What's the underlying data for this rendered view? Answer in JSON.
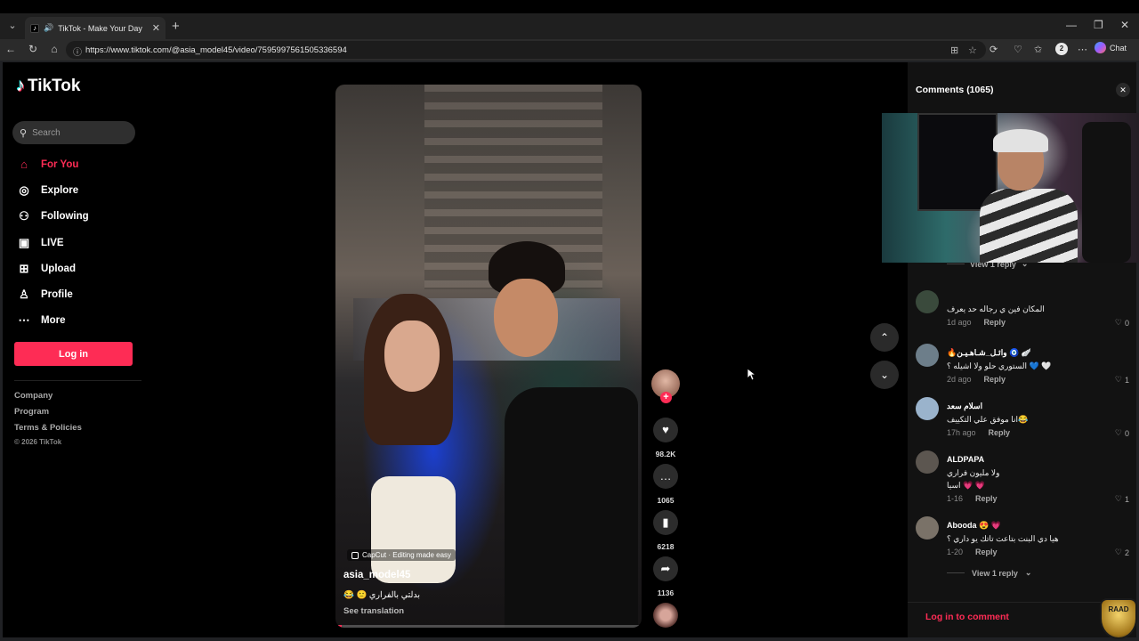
{
  "browser": {
    "tab_title": "TikTok - Make Your Day",
    "url": "https://www.tiktok.com/@asia_model45/video/7595997561505336594",
    "profile_initial": "2",
    "chat_label": "Chat"
  },
  "sidebar": {
    "logo_text": "TikTok",
    "search_placeholder": "Search",
    "nav": [
      {
        "label": "For You",
        "icon": "home-icon",
        "active": true
      },
      {
        "label": "Explore",
        "icon": "compass-icon"
      },
      {
        "label": "Following",
        "icon": "following-icon"
      },
      {
        "label": "LIVE",
        "icon": "live-icon"
      },
      {
        "label": "Upload",
        "icon": "upload-icon"
      },
      {
        "label": "Profile",
        "icon": "profile-icon"
      },
      {
        "label": "More",
        "icon": "more-icon"
      }
    ],
    "login_label": "Log in",
    "footer_links": [
      "Company",
      "Program",
      "Terms & Policies"
    ],
    "copyright": "© 2026 TikTok"
  },
  "video": {
    "capcut_label": "CapCut · Editing made easy",
    "author": "asia_model45",
    "caption": "بدلتي بالفراري 🙂 😂",
    "see_translation": "See translation",
    "progress": 0.02
  },
  "actions": {
    "likes": "98.2K",
    "comments": "1065",
    "saves": "6218",
    "shares": "1136"
  },
  "comments_panel": {
    "title": "Comments",
    "count": "(1065)",
    "view_reply_top": "View 1 reply",
    "items": [
      {
        "name": "",
        "text": "المكان فين ي رجاله حد يعرف",
        "text2": "",
        "time": "1d ago",
        "reply": "Reply",
        "likes": "0"
      },
      {
        "name": "🔥واﺋـﻞ_ﺷـﺎﻫـﻴـﻦ 🧿 🪽",
        "text": "الستوري حلو ولا اشيله ؟ 💙 🤍",
        "text2": "",
        "time": "2d ago",
        "reply": "Reply",
        "likes": "1"
      },
      {
        "name": "اسلام سعد",
        "text": "انا موفق علي التكييف😂",
        "text2": "",
        "time": "17h ago",
        "reply": "Reply",
        "likes": "0"
      },
      {
        "name": "ALDPAPA",
        "text": "ولا مليون فراري",
        "text2": "اسيا 💗 💗",
        "time": "1-16",
        "reply": "Reply",
        "likes": "1"
      },
      {
        "name": "Abooda 😍 💗",
        "text": "هيا دي البنت بتاعت تاتك يو داري ؟",
        "text2": "",
        "time": "1-20",
        "reply": "Reply",
        "likes": "2"
      }
    ],
    "view_reply_bottom": "View 1 reply",
    "login_to_comment": "Log in to comment"
  },
  "overlay": {
    "badge_text": "RAAD"
  }
}
